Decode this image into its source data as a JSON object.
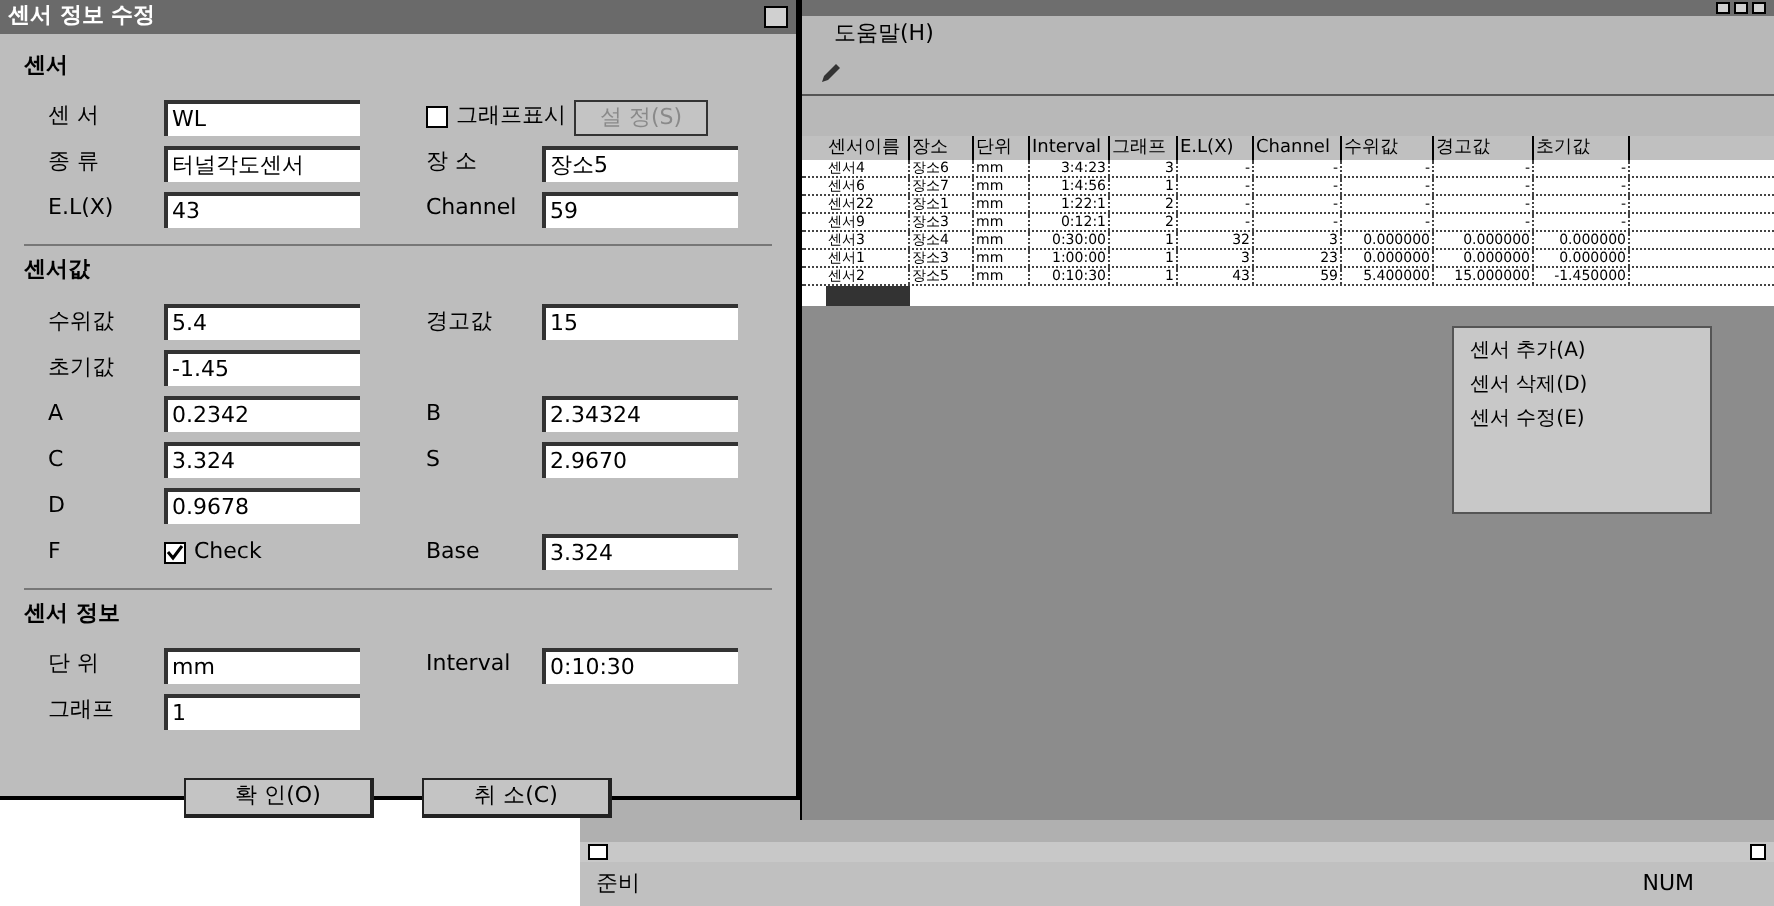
{
  "dialog": {
    "title": "센서 정보 수정",
    "groups": [
      {
        "title": "센서",
        "rows": [
          [
            {
              "kind": "field",
              "label": "센 서",
              "value": "WL"
            },
            {
              "kind": "checkbox",
              "label": "그래프표시",
              "checked": false,
              "button": {
                "label": "설 정(S)",
                "disabled": true
              }
            }
          ],
          [
            {
              "kind": "field",
              "label": "종 류",
              "value": "터널각도센서"
            },
            {
              "kind": "field",
              "label": "장 소",
              "value": "장소5"
            }
          ],
          [
            {
              "kind": "field",
              "label": "E.L(X)",
              "value": "43"
            },
            {
              "kind": "field",
              "label": "Channel",
              "value": "59"
            }
          ]
        ]
      },
      {
        "title": "센서값",
        "rows": [
          [
            {
              "kind": "field",
              "label": "수위값",
              "value": "5.4"
            },
            {
              "kind": "field",
              "label": "경고값",
              "value": "15"
            }
          ],
          [
            {
              "kind": "field",
              "label": "초기값",
              "value": "-1.45"
            }
          ],
          [
            {
              "kind": "field",
              "label": "A",
              "value": "0.2342"
            },
            {
              "kind": "field",
              "label": "B",
              "value": "2.34324"
            }
          ],
          [
            {
              "kind": "field",
              "label": "C",
              "value": "3.324"
            },
            {
              "kind": "field",
              "label": "S",
              "value": "2.9670"
            }
          ],
          [
            {
              "kind": "field",
              "label": "D",
              "value": "0.9678"
            }
          ],
          [
            {
              "kind": "check_field",
              "label": "F",
              "check_label": "Check",
              "checked": true
            },
            {
              "kind": "field",
              "label": "Base",
              "value": "3.324"
            }
          ]
        ]
      },
      {
        "title": "센서 정보",
        "rows": [
          [
            {
              "kind": "field",
              "label": "단 위",
              "value": "mm"
            },
            {
              "kind": "field",
              "label": "Interval",
              "value": "0:10:30"
            }
          ],
          [
            {
              "kind": "field",
              "label": "그래프",
              "value": "1"
            }
          ]
        ]
      }
    ],
    "buttons": [
      "확 인(O)",
      "취 소(C)"
    ]
  },
  "child_window": {
    "menu": [
      "도움말(H)"
    ],
    "table": {
      "columns": [
        "센서이름",
        "장소",
        "단위",
        "Interval",
        "그래프",
        "E.L(X)",
        "Channel",
        "수위값",
        "경고값",
        "초기값"
      ],
      "rows": [
        [
          "센서4",
          "장소6",
          "mm",
          "3:4:23",
          "3",
          "-",
          "-",
          "-",
          "-",
          "-"
        ],
        [
          "센서6",
          "장소7",
          "mm",
          "1:4:56",
          "1",
          "-",
          "-",
          "-",
          "-",
          "-"
        ],
        [
          "센서22",
          "장소1",
          "mm",
          "1:22:1",
          "2",
          "-",
          "-",
          "-",
          "-",
          "-"
        ],
        [
          "센서9",
          "장소3",
          "mm",
          "0:12:1",
          "2",
          "-",
          "-",
          "-",
          "-",
          "-"
        ],
        [
          "센서3",
          "장소4",
          "mm",
          "0:30:00",
          "1",
          "32",
          "3",
          "0.000000",
          "0.000000",
          "0.000000"
        ],
        [
          "센서1",
          "장소3",
          "mm",
          "1:00:00",
          "1",
          "3",
          "23",
          "0.000000",
          "0.000000",
          "0.000000"
        ],
        [
          "센서2",
          "장소5",
          "mm",
          "0:10:30",
          "1",
          "43",
          "59",
          "5.400000",
          "15.000000",
          "-1.450000"
        ]
      ],
      "new_row_selected": true
    },
    "context_menu": [
      "센서 추가(A)",
      "센서 삭제(D)",
      "센서 수정(E)"
    ]
  },
  "status_bar": {
    "left": "준비",
    "right": "NUM"
  }
}
